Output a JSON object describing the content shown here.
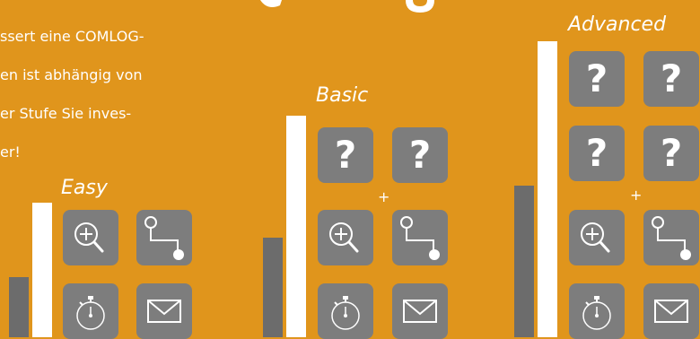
{
  "intro": {
    "lines": [
      "ssert eine COMLOG-",
      "en ist abhängig von",
      "er Stufe Sie inves-",
      "er!"
    ]
  },
  "tiers": [
    {
      "label": "Easy",
      "question_tiles": 0
    },
    {
      "label": "Basic",
      "question_tiles": 2,
      "plus": "+"
    },
    {
      "label": "Advanced",
      "question_tiles": 4,
      "plus": "+"
    }
  ],
  "tile_icons": [
    "question-mark-icon",
    "magnifier-plus-icon",
    "route-path-icon",
    "stopwatch-icon",
    "envelope-icon"
  ],
  "question_glyph": "?",
  "colors": {
    "background": "#e0951c",
    "tile": "#7d7d7d",
    "bar_white": "#ffffff",
    "bar_grey": "#6c6c6c",
    "text": "#ffffff"
  }
}
